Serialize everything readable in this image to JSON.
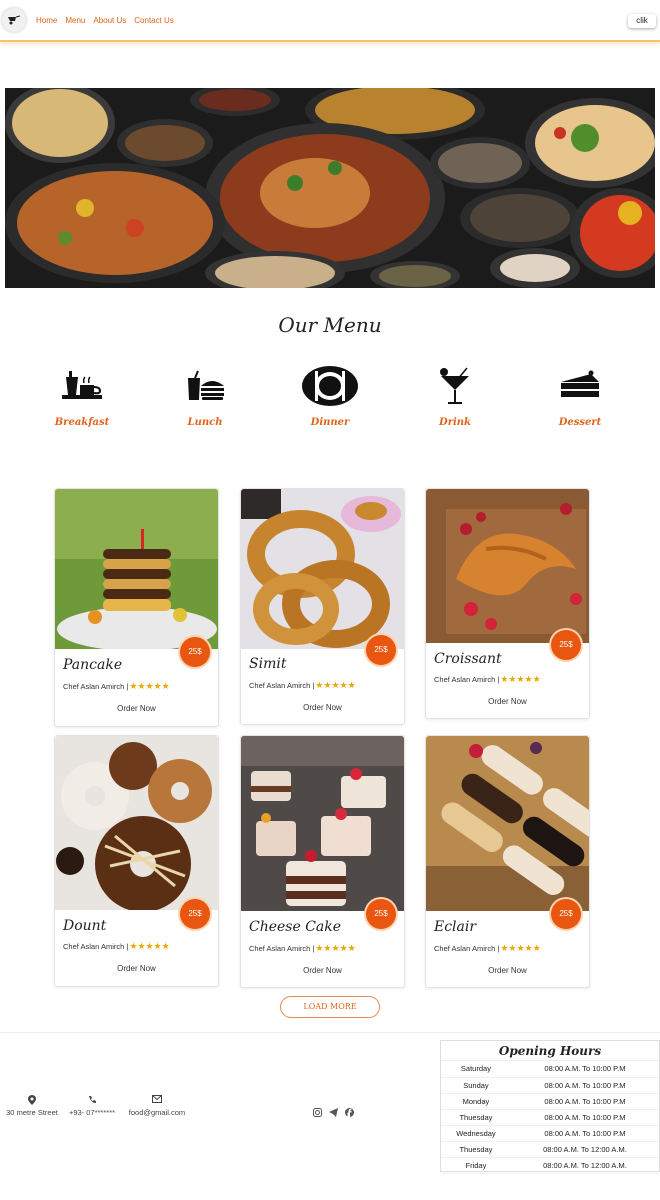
{
  "nav": {
    "items": [
      "Home",
      "Menu",
      "About Us",
      "Contact Us"
    ],
    "button": "clik"
  },
  "menu_title": "Our Menu",
  "categories": [
    {
      "label": "Breakfast",
      "icon": "breakfast-icon"
    },
    {
      "label": "Lunch",
      "icon": "burger-icon"
    },
    {
      "label": "Dinner",
      "icon": "dinner-plate-icon"
    },
    {
      "label": "Drink",
      "icon": "cocktail-icon"
    },
    {
      "label": "Dessert",
      "icon": "cake-slice-icon"
    }
  ],
  "cards": [
    {
      "name": "Pancake",
      "chef": "Chef Aslan Amirch |",
      "stars": "★★★★★",
      "price": "25$",
      "order": "Order Now"
    },
    {
      "name": "Simit",
      "chef": "Chef Aslan Amirch |",
      "stars": "★★★★★",
      "price": "25$",
      "order": "Order Now"
    },
    {
      "name": "Croissant",
      "chef": "Chef Aslan Amirch |",
      "stars": "★★★★★",
      "price": "25$",
      "order": "Order Now"
    },
    {
      "name": "Dount",
      "chef": "Chef Aslan Amirch |",
      "stars": "★★★★★",
      "price": "25$",
      "order": "Order Now"
    },
    {
      "name": "Cheese Cake",
      "chef": "Chef Aslan Amirch |",
      "stars": "★★★★★",
      "price": "25$",
      "order": "Order Now"
    },
    {
      "name": "Eclair",
      "chef": "Chef Aslan Amirch |",
      "stars": "★★★★★",
      "price": "25$",
      "order": "Order Now"
    }
  ],
  "load_more": "LOAD MORE",
  "footer": {
    "address": "30 metre Street",
    "phone": "+93- 07*******",
    "email": "food@gmail.com"
  },
  "hours": {
    "title": "Opening Hours",
    "rows": [
      {
        "day": "Saturday",
        "time": "08:00 A.M. To 10:00 P.M"
      },
      {
        "day": "Sunday",
        "time": "08:00 A.M. To 10:00 P.M"
      },
      {
        "day": "Monday",
        "time": "08:00 A.M. To 10:00 P.M"
      },
      {
        "day": "Thuesday",
        "time": "08:00 A.M. To 10:00 P.M"
      },
      {
        "day": "Wednesday",
        "time": "08:00 A.M. To 10:00 P.M"
      },
      {
        "day": "Thuesday",
        "time": "08:00 A.M. To 12:00 A.M."
      },
      {
        "day": "Friday",
        "time": "08:00 A.M. To 12:00 A.M."
      }
    ]
  },
  "colors": {
    "accent": "#e0641a",
    "price_badge": "#e8560f",
    "header_border": "#f4c56a",
    "star": "#e9a800"
  }
}
